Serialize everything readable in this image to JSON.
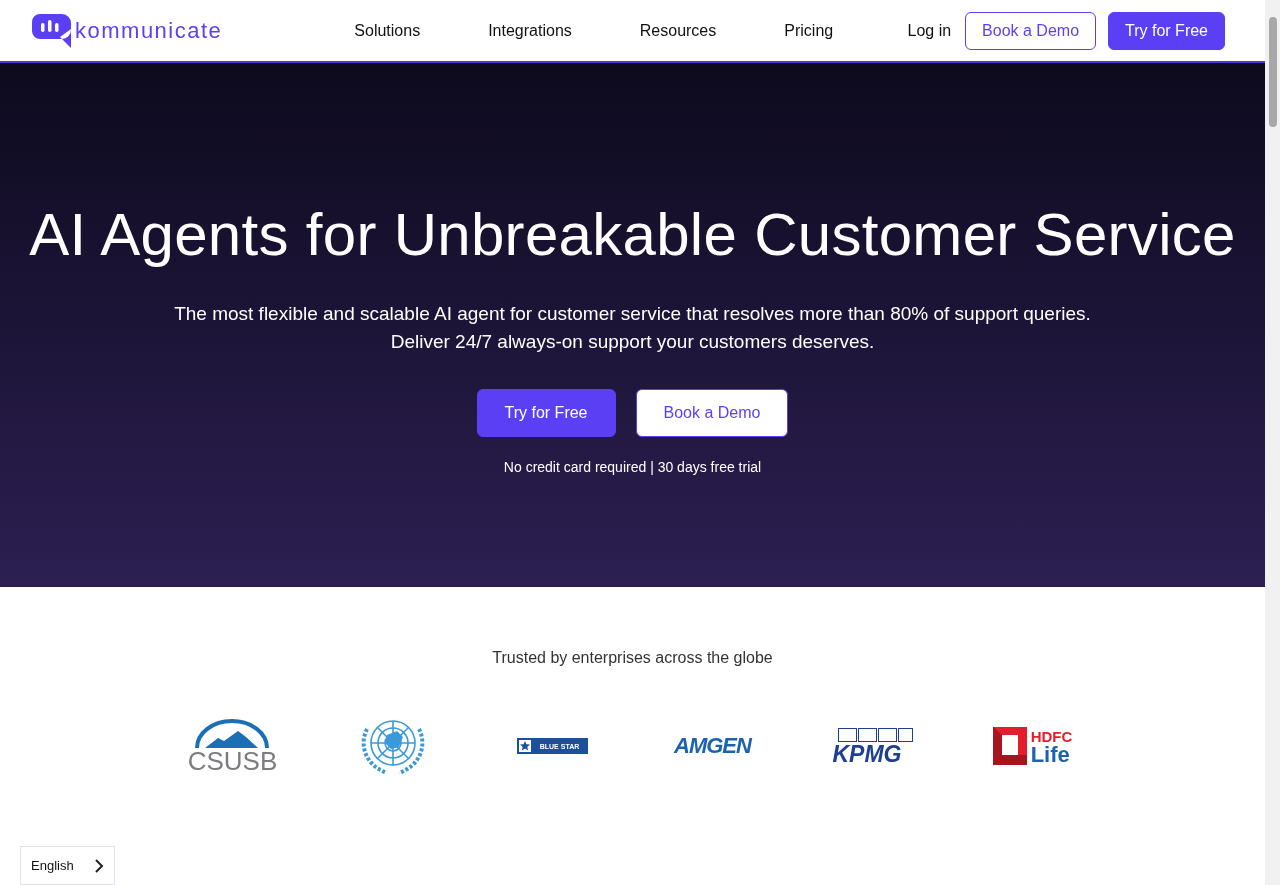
{
  "header": {
    "logo": {
      "text": "kommunicate"
    },
    "nav": [
      {
        "label": "Solutions"
      },
      {
        "label": "Integrations"
      },
      {
        "label": "Resources"
      },
      {
        "label": "Pricing"
      }
    ],
    "login": "Log in",
    "buttons": [
      {
        "label": "Book a Demo",
        "kind": "outline"
      },
      {
        "label": "Try for Free",
        "kind": "filled"
      }
    ]
  },
  "hero": {
    "title": "AI Agents for Unbreakable Customer Service",
    "subtitle": [
      "The most flexible and scalable AI agent for customer service that resolves more than 80% of support queries.",
      "Deliver 24/7 always-on support your customers deserves."
    ],
    "buttons": [
      {
        "label": "Try for Free",
        "kind": "filled"
      },
      {
        "label": "Book a Demo",
        "kind": "outline"
      }
    ],
    "note": "No credit card required | 30 days free trial"
  },
  "trusted": {
    "heading": "Trusted by enterprises across the globe",
    "logos": [
      {
        "kind": "arch",
        "text": "CSUSB"
      },
      {
        "kind": "emblem"
      },
      {
        "kind": "star",
        "text": "BLUE STAR"
      },
      {
        "kind": "plain",
        "text": "AMGEN"
      },
      {
        "kind": "boxes",
        "text": "KPMG"
      },
      {
        "kind": "square",
        "text": "HDFC",
        "text2": "Life"
      }
    ]
  },
  "language": {
    "label": "English"
  }
}
